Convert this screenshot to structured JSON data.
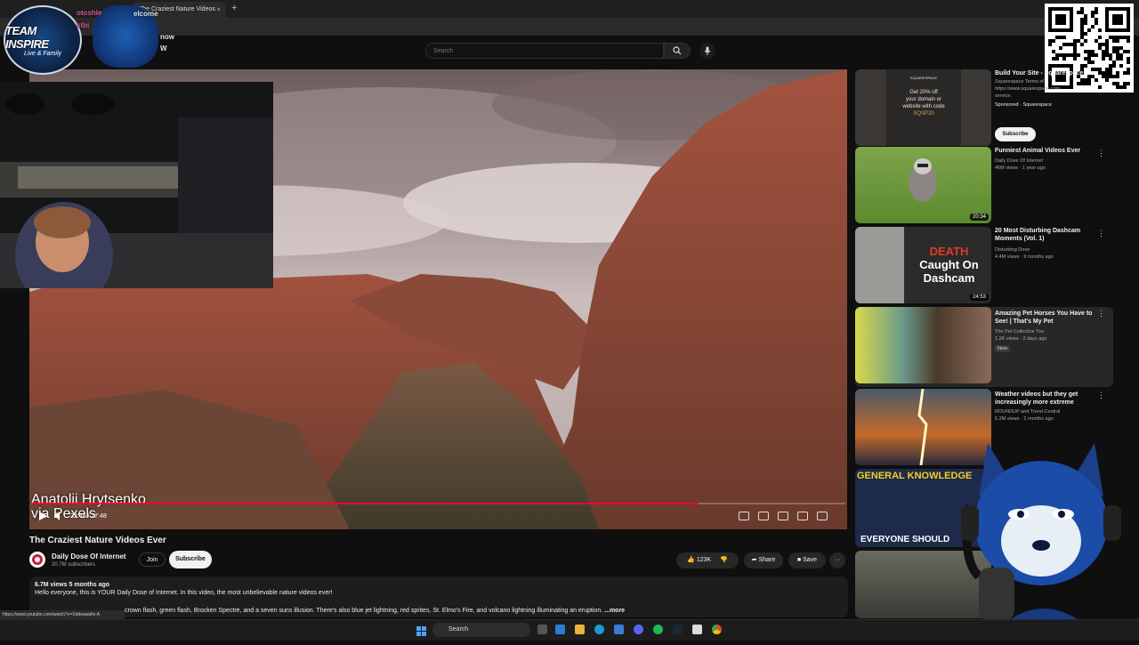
{
  "browser": {
    "tab_title": "The Craziest Nature Videos",
    "tab_close": "×",
    "new_tab": "+"
  },
  "search": {
    "placeholder": "Search"
  },
  "overlay": {
    "logo_line1": "TEAM INSPIRE",
    "logo_line2": "Live & Family",
    "chat": [
      "otoshle",
      "elcome",
      "stbi",
      "now",
      "W"
    ]
  },
  "video": {
    "overlay_credit_line1": "Anatolii Hrytsenko",
    "overlay_credit_line2": "via Pexels",
    "time": "22:45 / 27:48",
    "progress": 0.82,
    "title": "The Craziest Nature Videos Ever"
  },
  "channel": {
    "name": "Daily Dose Of Internet",
    "subscribers": "20.7M subscribers",
    "join_label": "Join",
    "subscribe_label": "Subscribe"
  },
  "actions": {
    "likes": "123K",
    "share": "Share",
    "save": "Save",
    "more": "···"
  },
  "description": {
    "meta": "6.7M views  5 months ago",
    "line1": "Hello everyone, this is YOUR Daily Dose of Internet. In this video, the most unbelievable nature videos ever!",
    "line2": "crown flash, green flash, Brocken Spectre, and a seven suns illusion. There's also blue jet lightning, red sprites, St. Elmo's Fire, and volcano lightning illuminating an eruption.",
    "more": "...more"
  },
  "status_url": "https://www.youtube.com/watch?v=Xddeawafix-A",
  "sidebar": [
    {
      "title": "Build Your Site - Squarespace",
      "meta1": "Squarespace Terms of",
      "meta2": "https://www.squarespace.com",
      "meta3": "service.",
      "sponsored": "Sponsored · Squarespace",
      "cta": "Subscribe",
      "ad_line1": "Get 20% off",
      "ad_line2": "your domain or",
      "ad_line3": "website with code",
      "ad_line4": "SQSP20",
      "ad_brand": "SQUARESPACE"
    },
    {
      "title": "Funniest Animal Videos Ever",
      "channel": "Daily Dose Of Internet",
      "meta": "46M views · 1 year ago",
      "duration": "20:34"
    },
    {
      "title": "20 Most Disturbing Dashcam Moments (Vol. 1)",
      "channel": "Disturbing Dose",
      "meta": "4.4M views · 9 months ago",
      "duration": "24:53",
      "thumb_red": "DEATH",
      "thumb_white1": "Caught On",
      "thumb_white2": "Dashcam"
    },
    {
      "title": "Amazing Pet Horses You Have to See! | That's My Pet",
      "channel": "The Pet Collective Too",
      "meta": "1.2K views · 2 days ago",
      "badge": "New"
    },
    {
      "title": "Weather videos but they get increasingly more extreme",
      "channel": "ROUNDUP and Trend Central",
      "meta": "5.2M views · 2 months ago"
    },
    {
      "thumb_line1": "GENERAL KNOWLEDGE",
      "thumb_line2": "EVERYONE SHOULD"
    }
  ],
  "taskbar": {
    "search_label": "Search"
  },
  "colors": {
    "accent": "#ff0033",
    "background": "#0f0f0f"
  }
}
